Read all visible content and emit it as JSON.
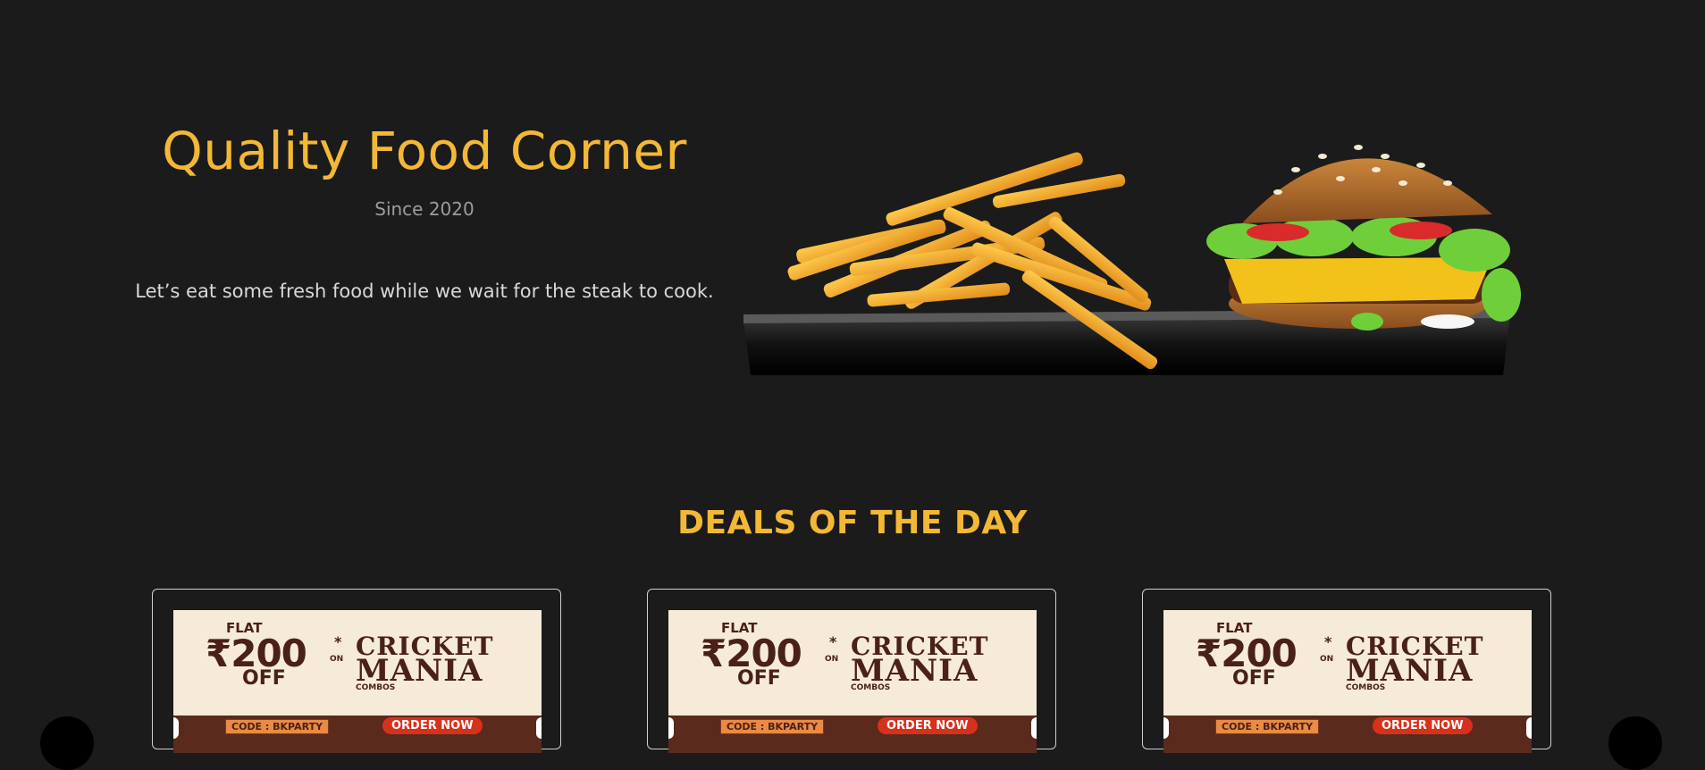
{
  "hero": {
    "title": "Quality Food Corner",
    "since": "Since 2020",
    "tagline": "Let’s eat some fresh food while we wait for the steak to cook.",
    "image_icon": "burger-fries-image"
  },
  "deals": {
    "title": "DEALS OF THE DAY",
    "cards": [
      {
        "flat": "FLAT",
        "amount": "₹200",
        "star": "*",
        "off": "OFF",
        "on": "ON",
        "cricket": "CRICKET",
        "mania": "MANIA",
        "combos": "COMBOS",
        "code": "CODE : BKPARTY",
        "order": "ORDER NOW"
      },
      {
        "flat": "FLAT",
        "amount": "₹200",
        "star": "*",
        "off": "OFF",
        "on": "ON",
        "cricket": "CRICKET",
        "mania": "MANIA",
        "combos": "COMBOS",
        "code": "CODE : BKPARTY",
        "order": "ORDER NOW"
      },
      {
        "flat": "FLAT",
        "amount": "₹200",
        "star": "*",
        "off": "OFF",
        "on": "ON",
        "cricket": "CRICKET",
        "mania": "MANIA",
        "combos": "COMBOS",
        "code": "CODE : BKPARTY",
        "order": "ORDER NOW"
      }
    ]
  },
  "colors": {
    "background": "#1b1b1b",
    "accent": "#f3b835",
    "banner_bg": "#f6ead8",
    "banner_brown": "#4a2116",
    "order_red": "#d6321b"
  }
}
